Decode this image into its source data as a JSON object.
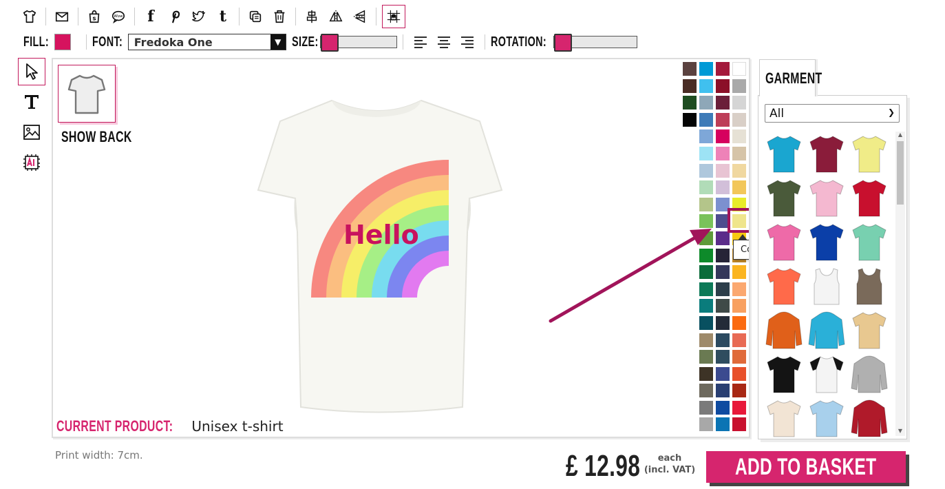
{
  "toolbar": {
    "social_f": "f",
    "social_t": "t"
  },
  "format_bar": {
    "fill_label": "FILL:",
    "fill_color": "#d6135e",
    "font_label": "FONT:",
    "font_value": "Fredoka One",
    "size_label": "SIZE:",
    "rotation_label": "ROTATION:"
  },
  "design": {
    "show_back_label": "SHOW BACK",
    "hello_text": "Hello",
    "current_product_label": "CURRENT PRODUCT:",
    "current_product_value": "Unisex t-shirt"
  },
  "palette": {
    "colors": [
      "#5b4240",
      "#009ad6",
      "#a41a3c",
      "#ffffff",
      "#4a2d25",
      "#40c0ef",
      "#8b0f28",
      "#a9a9a9",
      "#1e4d21",
      "#8ea7b8",
      "#6b1f3a",
      "#d5d5d5",
      "#050505",
      "#3e7bb8",
      "#bd3e58",
      "#d9cfc7",
      null,
      "#7ea7d8",
      "#d6005e",
      "#e6e1d5",
      null,
      "#9de3f5",
      "#ee82b8",
      "#d6c4a8",
      null,
      "#aec7dc",
      "#e8c4d3",
      "#f0d8a0",
      null,
      "#b1dcb8",
      "#d2bfd9",
      "#f2c75a",
      null,
      "#b4c58a",
      "#7c90cf",
      "#e8ec2a",
      null,
      "#7ac25a",
      "#4e4c8e",
      "#efe58c",
      null,
      "#5e9a3a",
      "#5b2c8a",
      "#f8ca10",
      null,
      "#0e8a2a",
      "#262437",
      "#c08a2a",
      null,
      "#0b6c3a",
      "#34375a",
      "#fbb520",
      null,
      "#0d7a58",
      "#2d3e4a",
      "#fba870",
      null,
      "#0a7c7c",
      "#3f4a48",
      "#f8a060",
      null,
      "#085060",
      "#232b38",
      "#fb6a10",
      null,
      "#9e8a6a",
      "#2c4a60",
      "#e86a54",
      null,
      "#6a7a52",
      "#2f4d5f",
      "#e06a3a",
      null,
      "#3d3326",
      "#3b4a8f",
      "#e8502a",
      null,
      "#6e6a5e",
      "#2a3f72",
      "#a82814",
      null,
      "#7a7a7a",
      "#0f4ba0",
      "#e8183a",
      null,
      "#a8a8a8",
      "#0b74b4",
      "#c8102e"
    ],
    "tooltip": "Cornsilk"
  },
  "garment": {
    "tab_label": "GARMENT",
    "filter_value": "All",
    "items": [
      {
        "name": "tshirt-turquoise",
        "color": "#1aa6d0"
      },
      {
        "name": "tshirt-maroon",
        "color": "#8a1c3a"
      },
      {
        "name": "tshirt-yellow",
        "color": "#f0ec88"
      },
      {
        "name": "tshirt-olive",
        "color": "#4a5a3a"
      },
      {
        "name": "tshirt-light-pink",
        "color": "#f4b8d0"
      },
      {
        "name": "tshirt-red",
        "color": "#c8102e"
      },
      {
        "name": "tshirt-pink",
        "color": "#ee6aa8"
      },
      {
        "name": "tshirt-royal-blue",
        "color": "#0b3fa8"
      },
      {
        "name": "tshirt-mint",
        "color": "#78d0b0"
      },
      {
        "name": "tshirt-coral",
        "color": "#ff6a4a"
      },
      {
        "name": "vest-white",
        "color": "#f4f4f4"
      },
      {
        "name": "vest-brown",
        "color": "#7a6a5a"
      },
      {
        "name": "hoodie-orange",
        "color": "#e0601a"
      },
      {
        "name": "hoodie-turquoise",
        "color": "#2ab0d8"
      },
      {
        "name": "tshirt-tie-dye",
        "color": "#e8c890"
      },
      {
        "name": "tshirt-black",
        "color": "#141414"
      },
      {
        "name": "raglan-black-white",
        "color": "#f4f4f4"
      },
      {
        "name": "hoodie-grey",
        "color": "#b0b0b0"
      },
      {
        "name": "tshirt-cream",
        "color": "#f2e4d4"
      },
      {
        "name": "tshirt-dip-dye-blue",
        "color": "#a8d0ec"
      },
      {
        "name": "varsity-jacket-red",
        "color": "#b01a2a"
      }
    ]
  },
  "footer": {
    "print_width": "Print width: 7cm.",
    "price": "£ 12.98",
    "each_line1": "each",
    "each_line2": "(incl. VAT)",
    "basket_label": "ADD TO BASKET"
  }
}
